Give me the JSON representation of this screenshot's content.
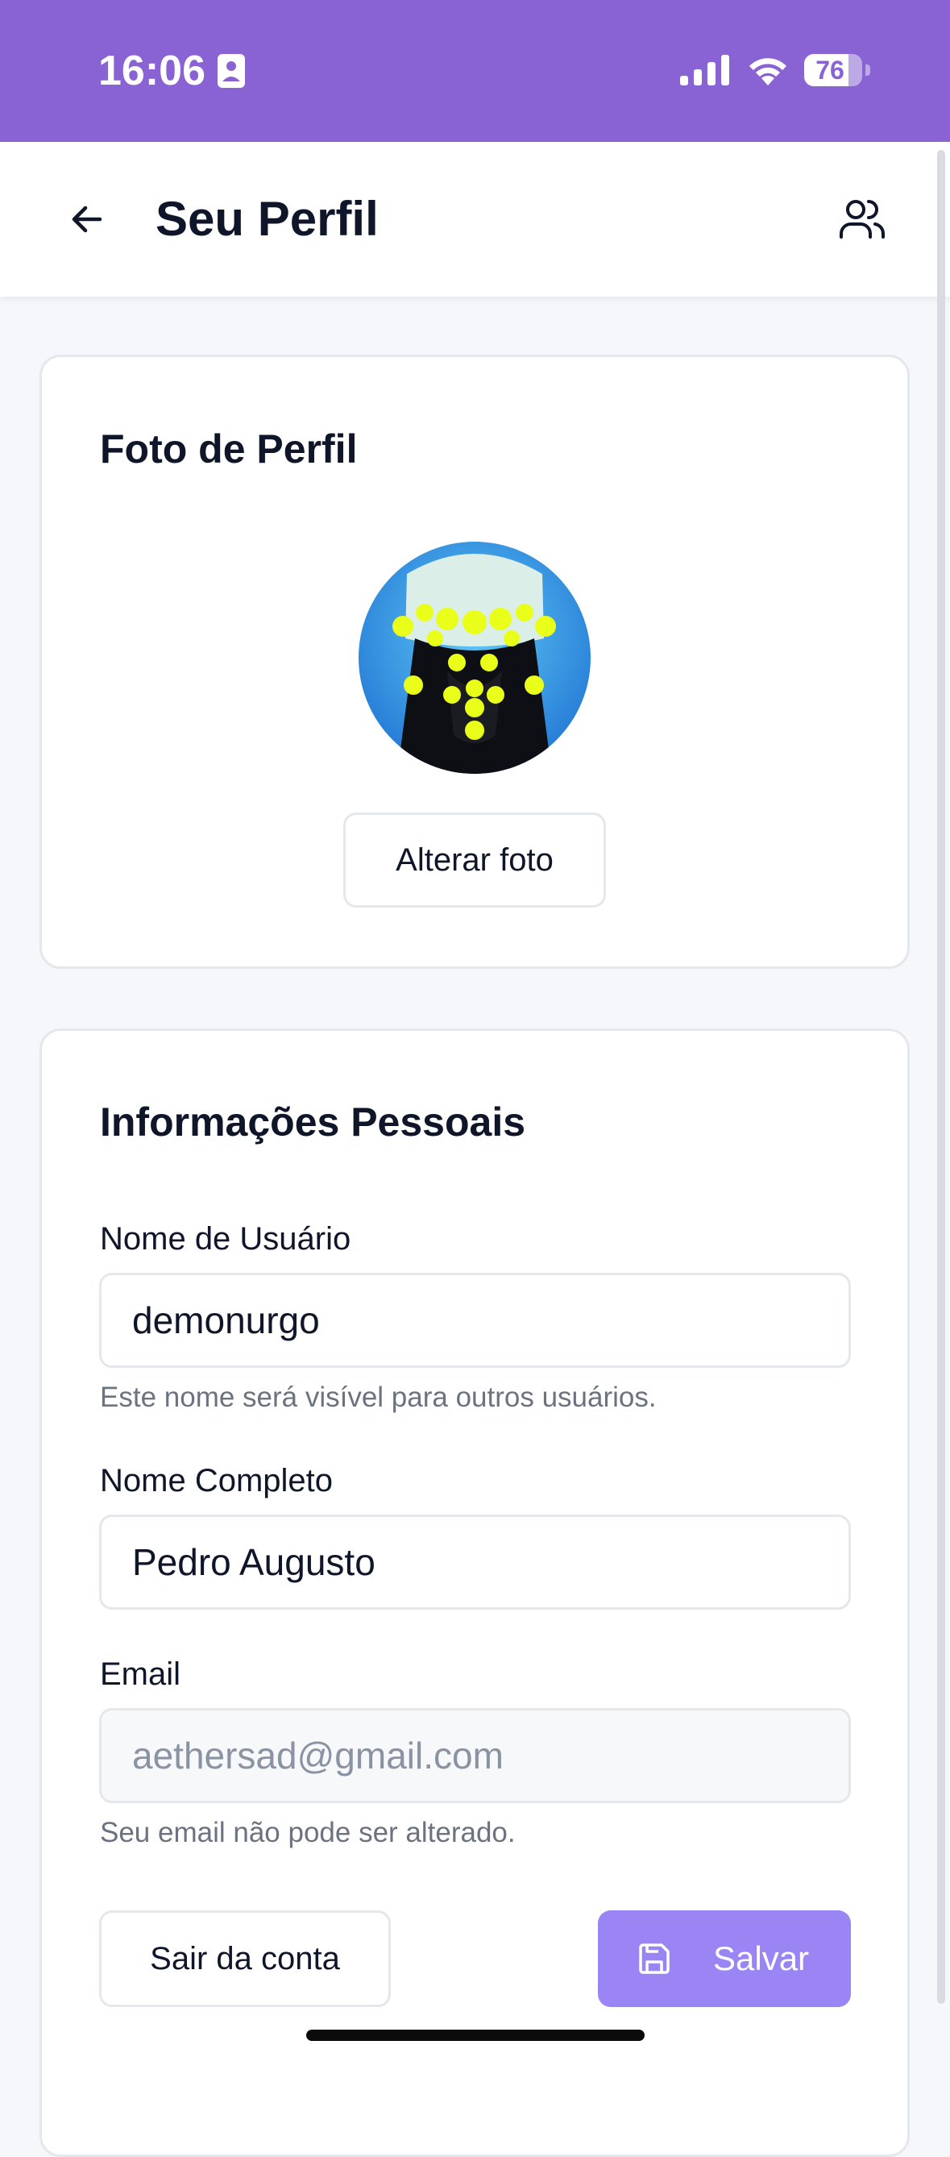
{
  "status_bar": {
    "time": "16:06",
    "battery_level": "76",
    "battery_fraction": 0.76,
    "icons": [
      "id-card-icon",
      "signal-icon",
      "wifi-icon",
      "battery-icon"
    ]
  },
  "header": {
    "title": "Seu Perfil",
    "back_icon": "arrow-left-icon",
    "action_icon": "users-icon"
  },
  "photo_card": {
    "title": "Foto de Perfil",
    "change_photo_label": "Alterar foto"
  },
  "info_card": {
    "title": "Informações Pessoais",
    "username": {
      "label": "Nome de Usuário",
      "value": "demonurgo",
      "helper": "Este nome será visível para outros usuários."
    },
    "full_name": {
      "label": "Nome Completo",
      "value": "Pedro Augusto"
    },
    "email": {
      "label": "Email",
      "value": "aethersad@gmail.com",
      "helper": "Seu email não pode ser alterado."
    },
    "logout_label": "Sair da conta",
    "save_label": "Salvar",
    "save_icon": "floppy-disk-icon"
  },
  "colors": {
    "status_bar": "#8963d4",
    "save_button": "#9b85f5",
    "background": "#f6f7fa"
  }
}
